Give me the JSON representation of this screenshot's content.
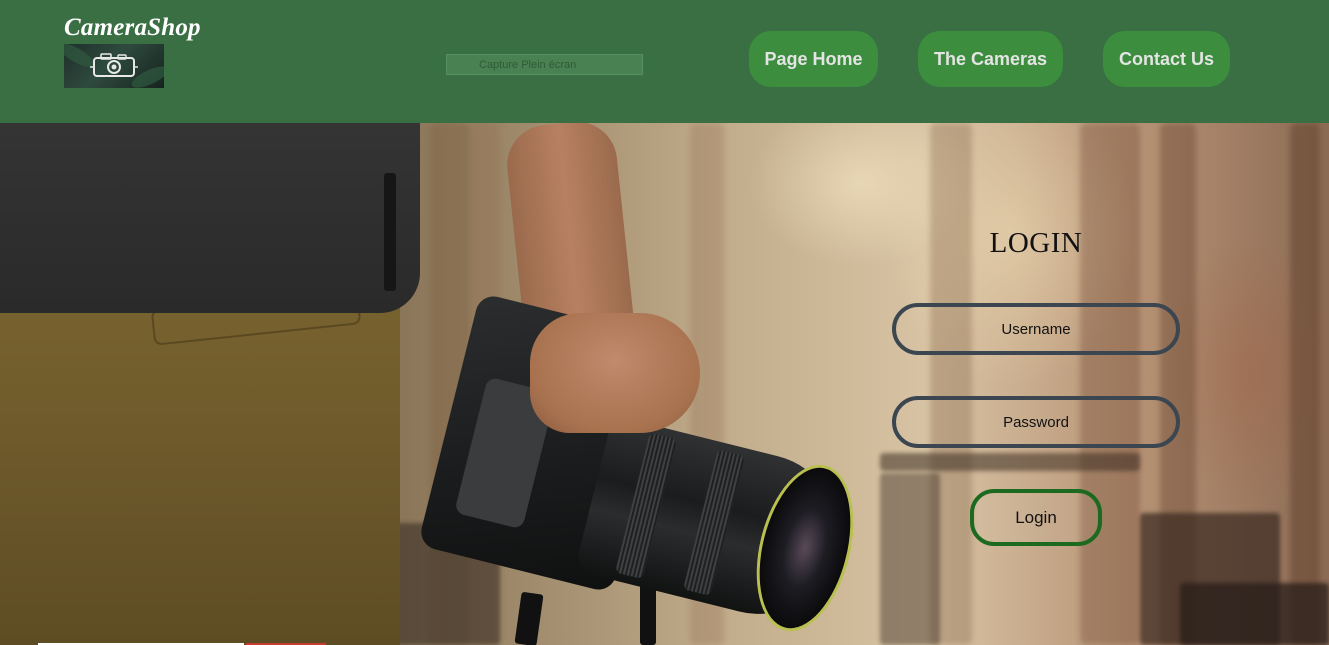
{
  "header": {
    "brand": "CameraShop",
    "logo_icon": "camera-icon",
    "search_placeholder": "Capture Plein écran",
    "nav": [
      {
        "label": "Page Home"
      },
      {
        "label": "The Cameras"
      },
      {
        "label": "Contact Us"
      }
    ]
  },
  "login": {
    "title": "LOGIN",
    "username_placeholder": "Username",
    "password_placeholder": "Password",
    "submit_label": "Login"
  },
  "colors": {
    "header_bg": "#3a6e43",
    "nav_button_bg": "#3c8e3e",
    "nav_text": "#e4e4e4",
    "input_border": "#3b4650",
    "login_button_border": "#1c6a1f"
  }
}
